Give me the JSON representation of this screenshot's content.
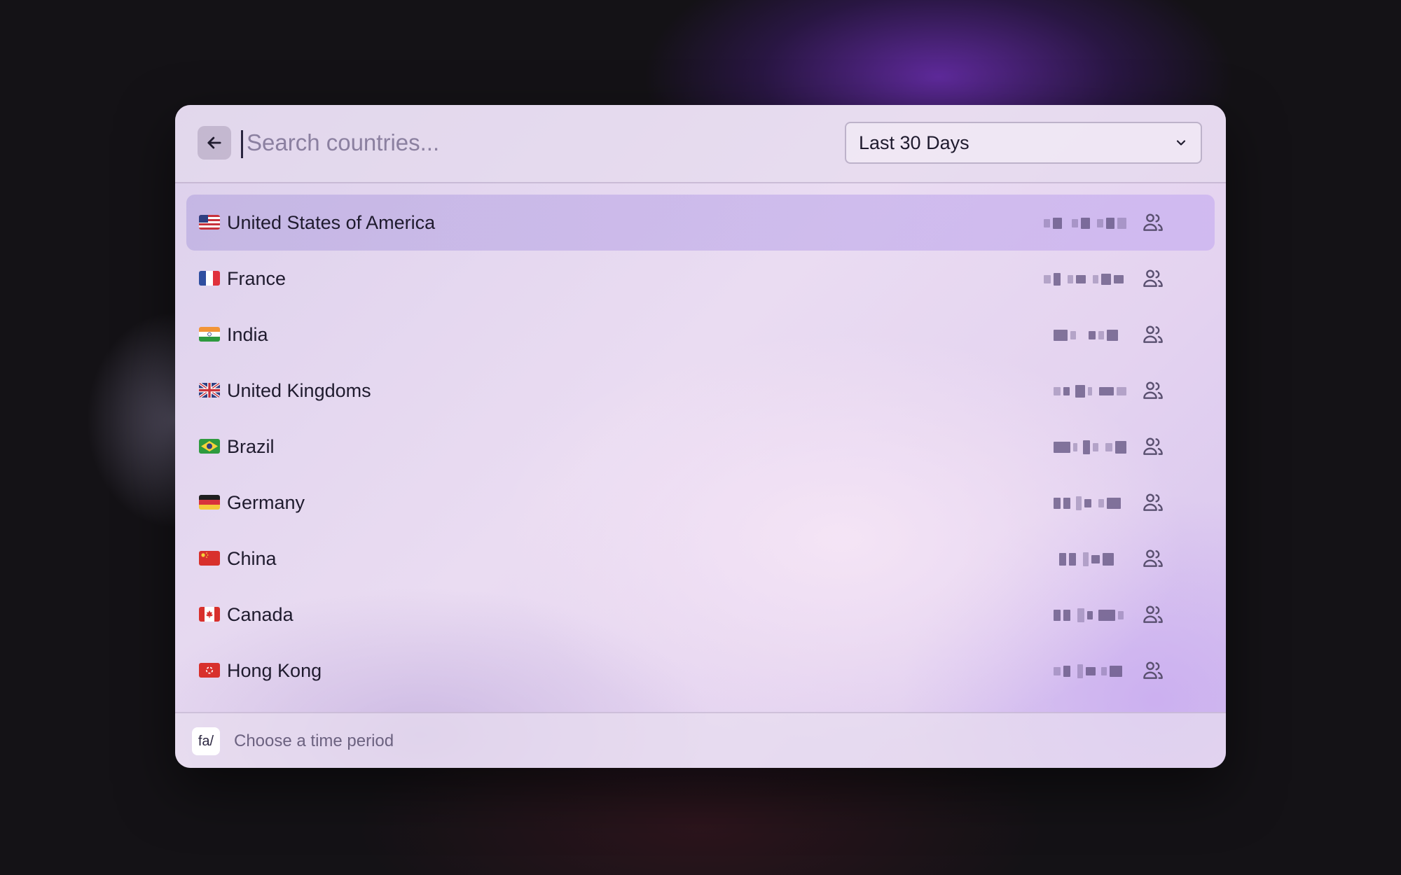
{
  "search": {
    "placeholder": "Search countries...",
    "value": ""
  },
  "period_select": {
    "selected": "Last 30 Days"
  },
  "countries": [
    {
      "name": "United States of America",
      "flag": "us",
      "selected": true
    },
    {
      "name": "France",
      "flag": "fr",
      "selected": false
    },
    {
      "name": "India",
      "flag": "in",
      "selected": false
    },
    {
      "name": "United Kingdoms",
      "flag": "gb",
      "selected": false
    },
    {
      "name": "Brazil",
      "flag": "br",
      "selected": false
    },
    {
      "name": "Germany",
      "flag": "de",
      "selected": false
    },
    {
      "name": "China",
      "flag": "cn",
      "selected": false
    },
    {
      "name": "Canada",
      "flag": "ca",
      "selected": false
    },
    {
      "name": "Hong Kong",
      "flag": "hk",
      "selected": false
    }
  ],
  "footer": {
    "shortcut_label": "fa/",
    "hint": "Choose a time period"
  },
  "icons": {
    "back": "arrow-left-icon",
    "dropdown": "chevron-down-icon",
    "row_action": "users-icon"
  },
  "colors": {
    "selected_row": "#c4b0ea",
    "text": "#1f1b2e",
    "muted": "#6c6280"
  }
}
